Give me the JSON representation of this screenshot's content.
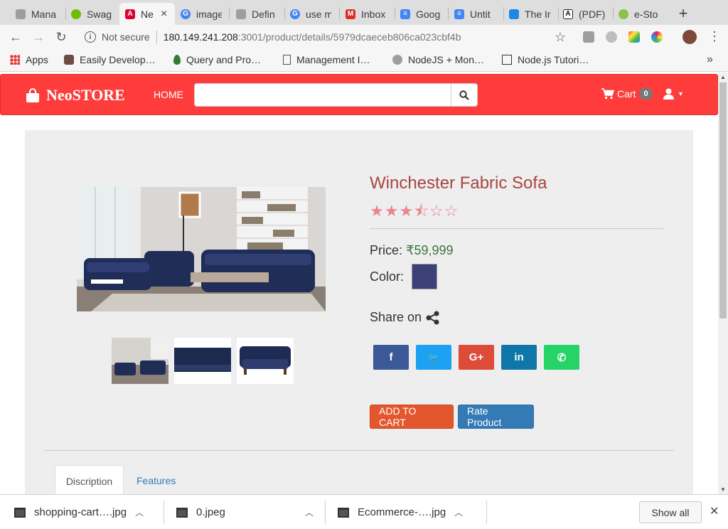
{
  "browser": {
    "tabs": [
      {
        "title": "Mana",
        "icon": "file-icon",
        "color": "#5f6368"
      },
      {
        "title": "Swag",
        "icon": "swagger-icon",
        "color": "#6cbf00"
      },
      {
        "title": "Ne",
        "icon": "angular-icon",
        "color": "#dd0031",
        "active": true
      },
      {
        "title": "image",
        "icon": "google-icon",
        "color": "#4285f4"
      },
      {
        "title": "Defin",
        "icon": "file-icon",
        "color": "#5f6368"
      },
      {
        "title": "use m",
        "icon": "google-icon",
        "color": "#4285f4"
      },
      {
        "title": "Inbox",
        "icon": "gmail-icon",
        "color": "#d93025"
      },
      {
        "title": "Goog",
        "icon": "docs-icon",
        "color": "#4285f4"
      },
      {
        "title": "Untit",
        "icon": "docs-icon",
        "color": "#4285f4"
      },
      {
        "title": "The Ir",
        "icon": "site-icon",
        "color": "#1e88e5"
      },
      {
        "title": "(PDF)",
        "icon": "academia-icon",
        "color": "#222222"
      },
      {
        "title": "e-Sto",
        "icon": "android-icon",
        "color": "#8bc34a"
      }
    ],
    "tab_close": "×",
    "new_tab": "+",
    "address": {
      "security": "Not secure",
      "host": "180.149.241.208",
      "path": ":3001/product/details/5979dcaeceb806ca023cbf4b"
    },
    "bookmarks": [
      {
        "label": "Apps",
        "icon": "apps-grid-icon"
      },
      {
        "label": "Easily Develop…",
        "icon": "bookmark-site-icon"
      },
      {
        "label": "Query and Pro…",
        "icon": "mongodb-leaf-icon"
      },
      {
        "label": "Management I…",
        "icon": "file-icon"
      },
      {
        "label": "NodeJS + Mon…",
        "icon": "node-icon"
      },
      {
        "label": "Node.js Tutori…",
        "icon": "tutorial-icon"
      }
    ],
    "bookmarks_more": "»"
  },
  "site": {
    "brand": "NeoSTORE",
    "nav_home": "HOME",
    "search_placeholder": "",
    "cart_label": "Cart",
    "cart_count": "0"
  },
  "product": {
    "title": "Winchester Fabric Sofa",
    "rating": 3.5,
    "rating_max": 5,
    "stars": {
      "full": "★★★",
      "half": "⯪",
      "empty": "☆☆"
    },
    "price_label": "Price:",
    "price": "₹59,999",
    "color_label": "Color:",
    "color_value": "#3b4177",
    "share_label": "Share on",
    "social": [
      {
        "name": "facebook",
        "glyph": "f",
        "color": "#3b5998"
      },
      {
        "name": "twitter",
        "glyph": "🐦",
        "color": "#1da1f2"
      },
      {
        "name": "google-plus",
        "glyph": "G+",
        "color": "#dd4b39"
      },
      {
        "name": "linkedin",
        "glyph": "in",
        "color": "#0e76a8"
      },
      {
        "name": "whatsapp",
        "glyph": "✆",
        "color": "#25d366"
      }
    ],
    "add_to_cart": "ADD TO CART",
    "rate_product": "Rate Product",
    "tabs": {
      "description": "Discription",
      "features": "Features"
    }
  },
  "downloads": {
    "items": [
      {
        "name": "shopping-cart….jpg"
      },
      {
        "name": "0.jpeg"
      },
      {
        "name": "Ecommerce-….jpg"
      }
    ],
    "show_all": "Show all",
    "close": "✕"
  }
}
